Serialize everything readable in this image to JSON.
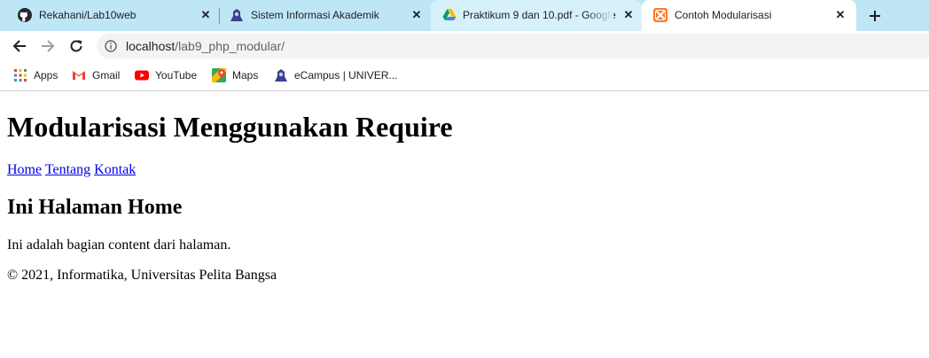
{
  "browser": {
    "tabs": [
      {
        "title": "Rekahani/Lab10web",
        "icon": "github-icon",
        "state": "inactive"
      },
      {
        "title": "Sistem Informasi Akademik",
        "icon": "campus-logo-icon",
        "state": "inactive"
      },
      {
        "title": "Praktikum 9 dan 10.pdf - Google",
        "icon": "google-drive-icon",
        "state": "hover"
      },
      {
        "title": "Contoh Modularisasi",
        "icon": "xampp-icon",
        "state": "active"
      }
    ],
    "address": {
      "host": "localhost",
      "path": "/lab9_php_modular/"
    },
    "bookmarks": [
      {
        "label": "Apps",
        "icon": "apps-grid-icon"
      },
      {
        "label": "Gmail",
        "icon": "gmail-icon"
      },
      {
        "label": "YouTube",
        "icon": "youtube-icon"
      },
      {
        "label": "Maps",
        "icon": "maps-icon"
      },
      {
        "label": "eCampus | UNIVER...",
        "icon": "campus-logo-icon"
      }
    ]
  },
  "page": {
    "heading": "Modularisasi Menggunakan Require",
    "nav_links": [
      "Home",
      "Tentang",
      "Kontak"
    ],
    "subheading": "Ini Halaman Home",
    "content": "Ini adalah bagian content dari halaman.",
    "footer": "© 2021, Informatika, Universitas Pelita Bangsa"
  },
  "colors": {
    "tabstrip": "#bfe6f5",
    "active_tab": "#ffffff",
    "hover_tab": "#d7f1fb",
    "link": "#0000ee",
    "omnibox": "#f1f3f4"
  }
}
